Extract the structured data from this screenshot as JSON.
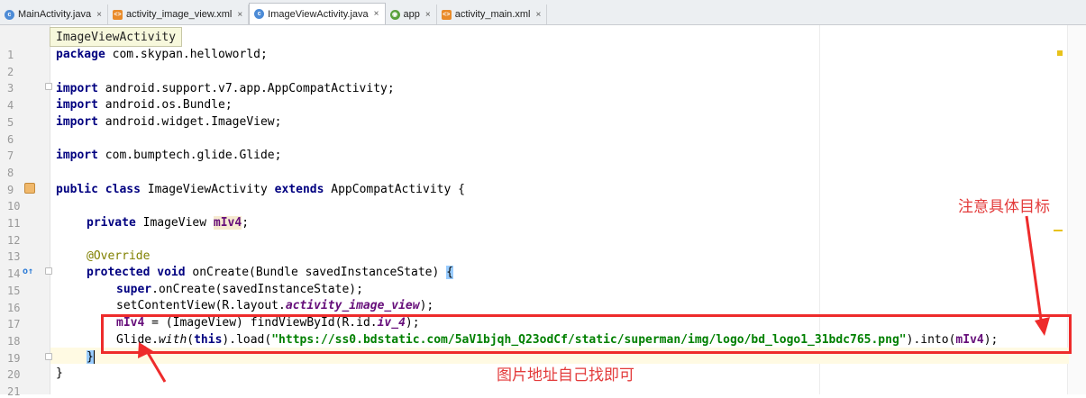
{
  "tabs": [
    {
      "label": "MainActivity.java",
      "icon": "java-class-icon",
      "active": false
    },
    {
      "label": "activity_image_view.xml",
      "icon": "xml-layout-icon",
      "active": false
    },
    {
      "label": "ImageViewActivity.java",
      "icon": "java-class-icon",
      "active": true
    },
    {
      "label": "app",
      "icon": "android-module-icon",
      "active": false
    },
    {
      "label": "activity_main.xml",
      "icon": "xml-layout-icon",
      "active": false
    }
  ],
  "tooltip": "ImageViewActivity",
  "line_numbers": [
    "1",
    "2",
    "3",
    "4",
    "5",
    "6",
    "7",
    "8",
    "9",
    "10",
    "11",
    "12",
    "13",
    "14",
    "15",
    "16",
    "17",
    "18",
    "19",
    "20",
    "21"
  ],
  "code": {
    "l1_kw": "package",
    "l1_rest": " com.skypan.helloworld;",
    "l3_kw": "import",
    "l3_rest": " android.support.v7.app.AppCompatActivity;",
    "l4_kw": "import",
    "l4_rest": " android.os.Bundle;",
    "l5_kw": "import",
    "l5_rest": " android.widget.ImageView;",
    "l7_kw": "import",
    "l7_rest": " com.bumptech.glide.Glide;",
    "l9_kw1": "public class",
    "l9_mid": " ImageViewActivity ",
    "l9_kw2": "extends",
    "l9_rest": " AppCompatActivity {",
    "l11_kw": "private",
    "l11_mid": " ImageView ",
    "l11_fld": "mIv4",
    "l11_rest": ";",
    "l13_ann": "@Override",
    "l14_kw": "protected void",
    "l14_rest": " onCreate(Bundle savedInstanceState) ",
    "l14_brace": "{",
    "l15_kw": "super",
    "l15_rest": ".onCreate(savedInstanceState);",
    "l16_a": "setContentView(R.layout.",
    "l16_fld": "activity_image_view",
    "l16_b": ");",
    "l17_fld": "mIv4",
    "l17_a": " = (ImageView) findViewById(R.id.",
    "l17_fld2": "iv_4",
    "l17_b": ");",
    "l18_a": "Glide.",
    "l18_with": "with",
    "l18_b": "(",
    "l18_kw": "this",
    "l18_c": ").load(",
    "l18_str": "\"https://ss0.bdstatic.com/5aV1bjqh_Q23odCf/static/superman/img/logo/bd_logo1_31bdc765.png\"",
    "l18_d": ").into(",
    "l18_fld": "mIv4",
    "l18_e": ");",
    "l19_brace": "}",
    "l20": "}"
  },
  "annotations": {
    "note_target": "注意具体目标",
    "note_url": "图片地址自己找即可"
  },
  "colors": {
    "annotation_red": "#ee2b2b",
    "keyword": "#000080",
    "field": "#660e7a",
    "string": "#008000",
    "metadata": "#808000"
  }
}
